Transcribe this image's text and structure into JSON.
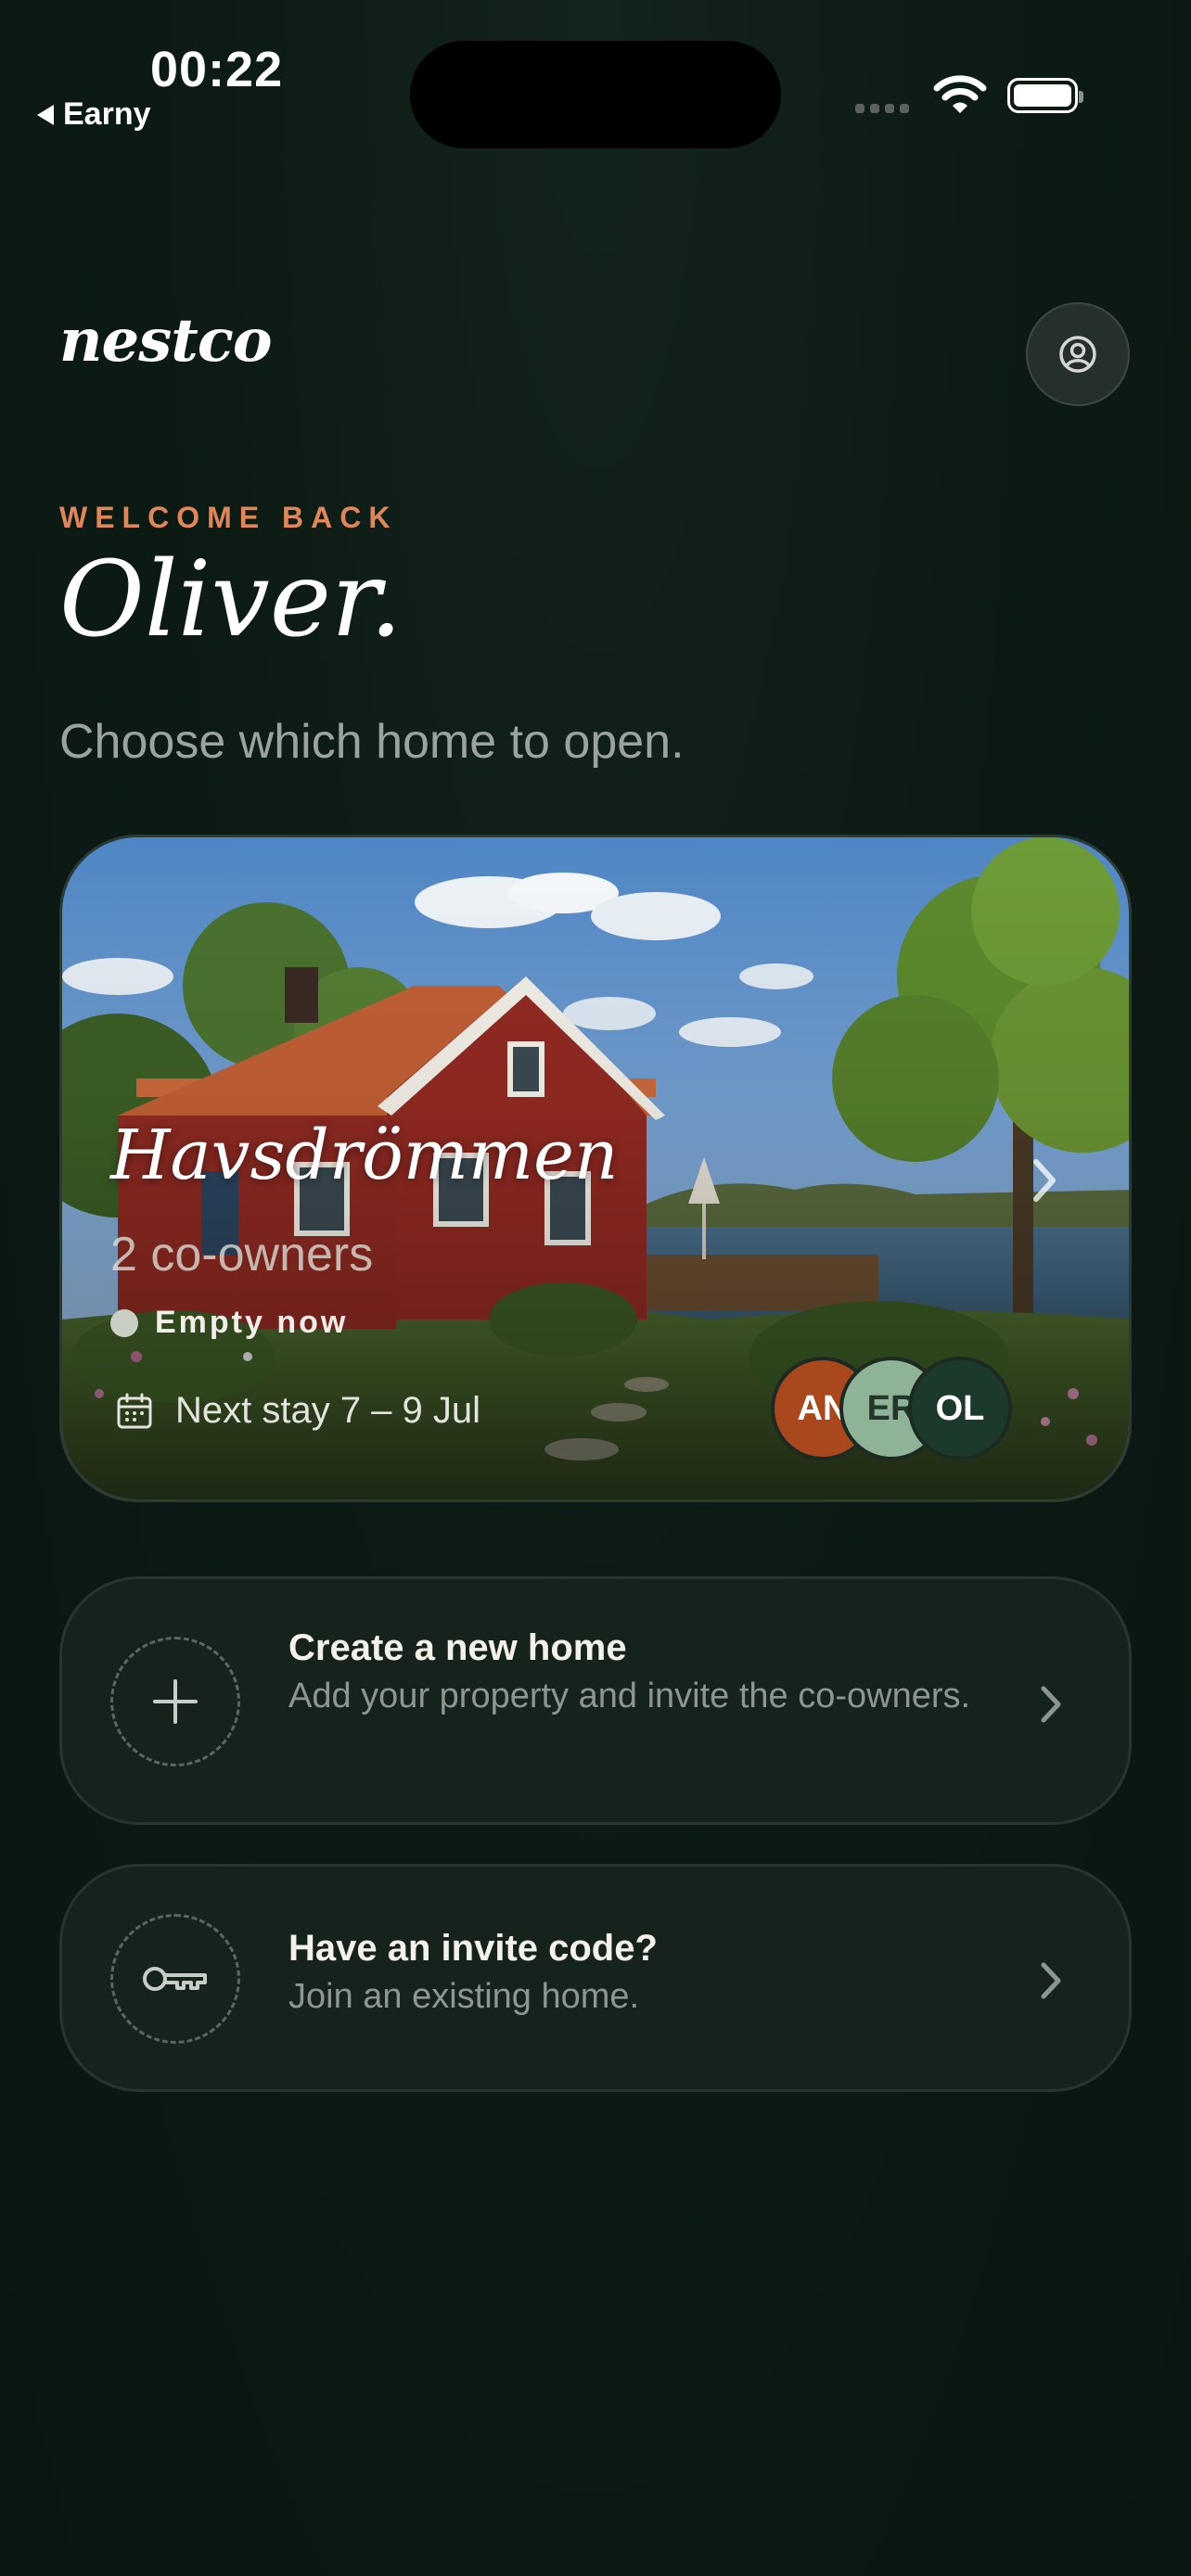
{
  "status_bar": {
    "time": "00:22",
    "back_label": "Earny"
  },
  "header": {
    "logo": "nestco",
    "profile_icon": "user-circle-icon"
  },
  "greeting": {
    "eyebrow": "WELCOME BACK",
    "name": "Oliver.",
    "subtitle": "Choose which home to open."
  },
  "home": {
    "name": "Havsdrömmen",
    "owners": "2 co-owners",
    "status": "Empty now",
    "next_stay": "Next stay 7 – 9 Jul",
    "avatars": [
      {
        "initials": "AN",
        "color": "#a9481c",
        "text_color": "#ffffff"
      },
      {
        "initials": "ER",
        "color": "#8fb397",
        "text_color": "#24362b"
      },
      {
        "initials": "OL",
        "color": "#1c3a2c",
        "text_color": "#ffffff"
      }
    ]
  },
  "actions": [
    {
      "title": "Create a new home",
      "description": "Add your property and invite the co-owners.",
      "icon": "plus-icon"
    },
    {
      "title": "Have an invite code?",
      "description": "Join an existing home.",
      "icon": "key-icon"
    }
  ],
  "colors": {
    "background": "#0c1a14",
    "accent": "#e0875a",
    "card": "#16231d"
  }
}
